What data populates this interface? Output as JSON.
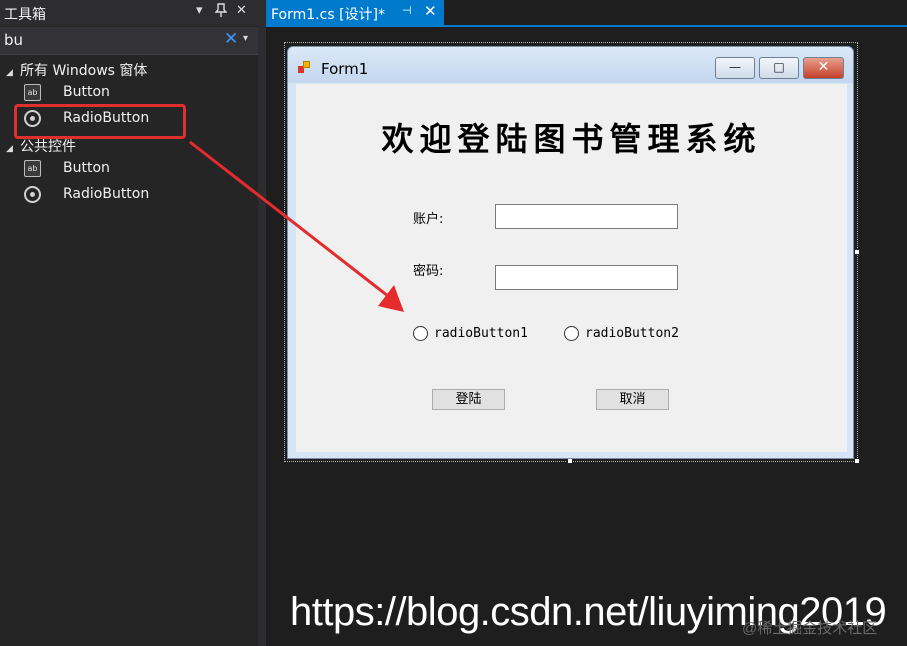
{
  "toolbox": {
    "title": "工具箱",
    "header_controls": {
      "dropdown": "▾",
      "pin": "📌",
      "close": "✕"
    },
    "search": {
      "value": "bu",
      "clear": "✕",
      "dropdown": "▾"
    },
    "categories": [
      {
        "label": "所有 Windows 窗体",
        "expanded": true,
        "items": [
          {
            "label": "Button",
            "icon": "button-icon"
          },
          {
            "label": "RadioButton",
            "icon": "radio-button-icon"
          }
        ]
      },
      {
        "label": "公共控件",
        "expanded": true,
        "items": [
          {
            "label": "Button",
            "icon": "button-icon"
          },
          {
            "label": "RadioButton",
            "icon": "radio-button-icon"
          }
        ]
      }
    ],
    "highlighted_item": "RadioButton"
  },
  "document_tab": {
    "label": "Form1.cs [设计]*",
    "pin": "⊣",
    "close": "✕"
  },
  "form": {
    "title": "Form1",
    "window_buttons": {
      "minimize": "—",
      "maximize": "□",
      "close": "✕"
    },
    "heading": "欢迎登陆图书管理系统",
    "account_label": "账户:",
    "password_label": "密码:",
    "account_value": "",
    "password_value": "",
    "radio1": "radioButton1",
    "radio2": "radioButton2",
    "login_button": "登陆",
    "cancel_button": "取消"
  },
  "watermark": "https://blog.csdn.net/liuyiming2019",
  "watermark_small": "@稀土掘金技术社区",
  "colors": {
    "accent": "#007acc",
    "highlight": "#e02f2f",
    "background": "#1e1e1e"
  }
}
